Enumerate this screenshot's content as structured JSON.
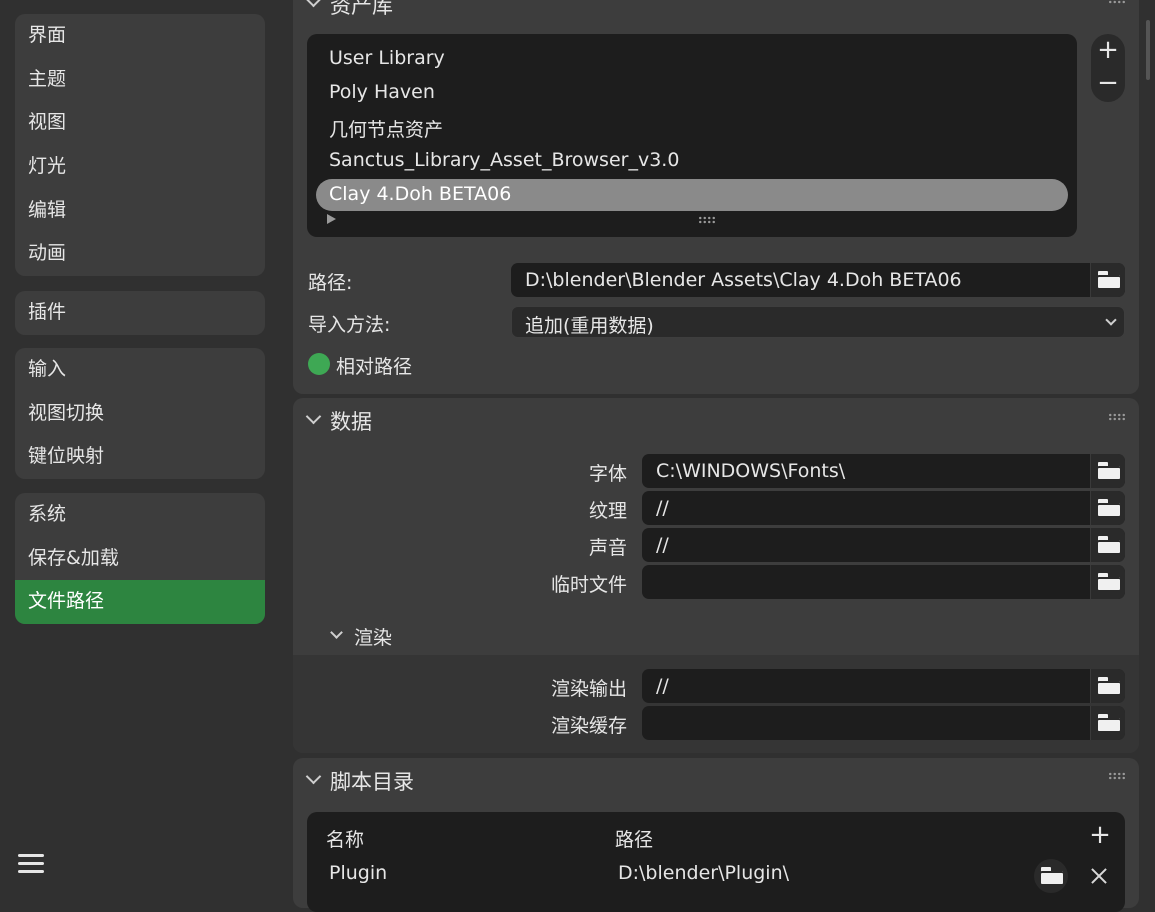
{
  "sidebar": {
    "group1": [
      "界面",
      "主题",
      "视图",
      "灯光",
      "编辑",
      "动画"
    ],
    "group2": [
      "插件"
    ],
    "group3": [
      "输入",
      "视图切换",
      "键位映射"
    ],
    "group4": [
      "系统",
      "保存&加载",
      "文件路径"
    ],
    "active": "文件路径"
  },
  "asset_library": {
    "title": "资产库",
    "libraries": [
      "User Library",
      "Poly Haven",
      "几何节点资产",
      "Sanctus_Library_Asset_Browser_v3.0",
      "Clay 4.Doh BETA06"
    ],
    "selected": "Clay 4.Doh BETA06",
    "add_label": "+",
    "remove_label": "−",
    "path_label": "路径:",
    "path_value": "D:\\blender\\Blender Assets\\Clay 4.Doh BETA06",
    "import_label": "导入方法:",
    "import_value": "追加(重用数据)",
    "relative_label": "相对路径"
  },
  "data": {
    "title": "数据",
    "rows": [
      {
        "label": "字体",
        "value": "C:\\WINDOWS\\Fonts\\"
      },
      {
        "label": "纹理",
        "value": "//"
      },
      {
        "label": "声音",
        "value": "//"
      },
      {
        "label": "临时文件",
        "value": ""
      }
    ],
    "render": {
      "title": "渲染",
      "rows": [
        {
          "label": "渲染输出",
          "value": "//"
        },
        {
          "label": "渲染缓存",
          "value": ""
        }
      ]
    }
  },
  "scripts": {
    "title": "脚本目录",
    "col_name": "名称",
    "col_path": "路径",
    "add_label": "+",
    "rows": [
      {
        "name": "Plugin",
        "path": "D:\\blender\\Plugin\\"
      }
    ]
  },
  "colors": {
    "accent": "#2d8540",
    "checkbox": "#3ea854"
  },
  "icons": [
    "folder-icon",
    "menu-icon",
    "chevron-down-icon",
    "close-icon",
    "grip-icon"
  ]
}
